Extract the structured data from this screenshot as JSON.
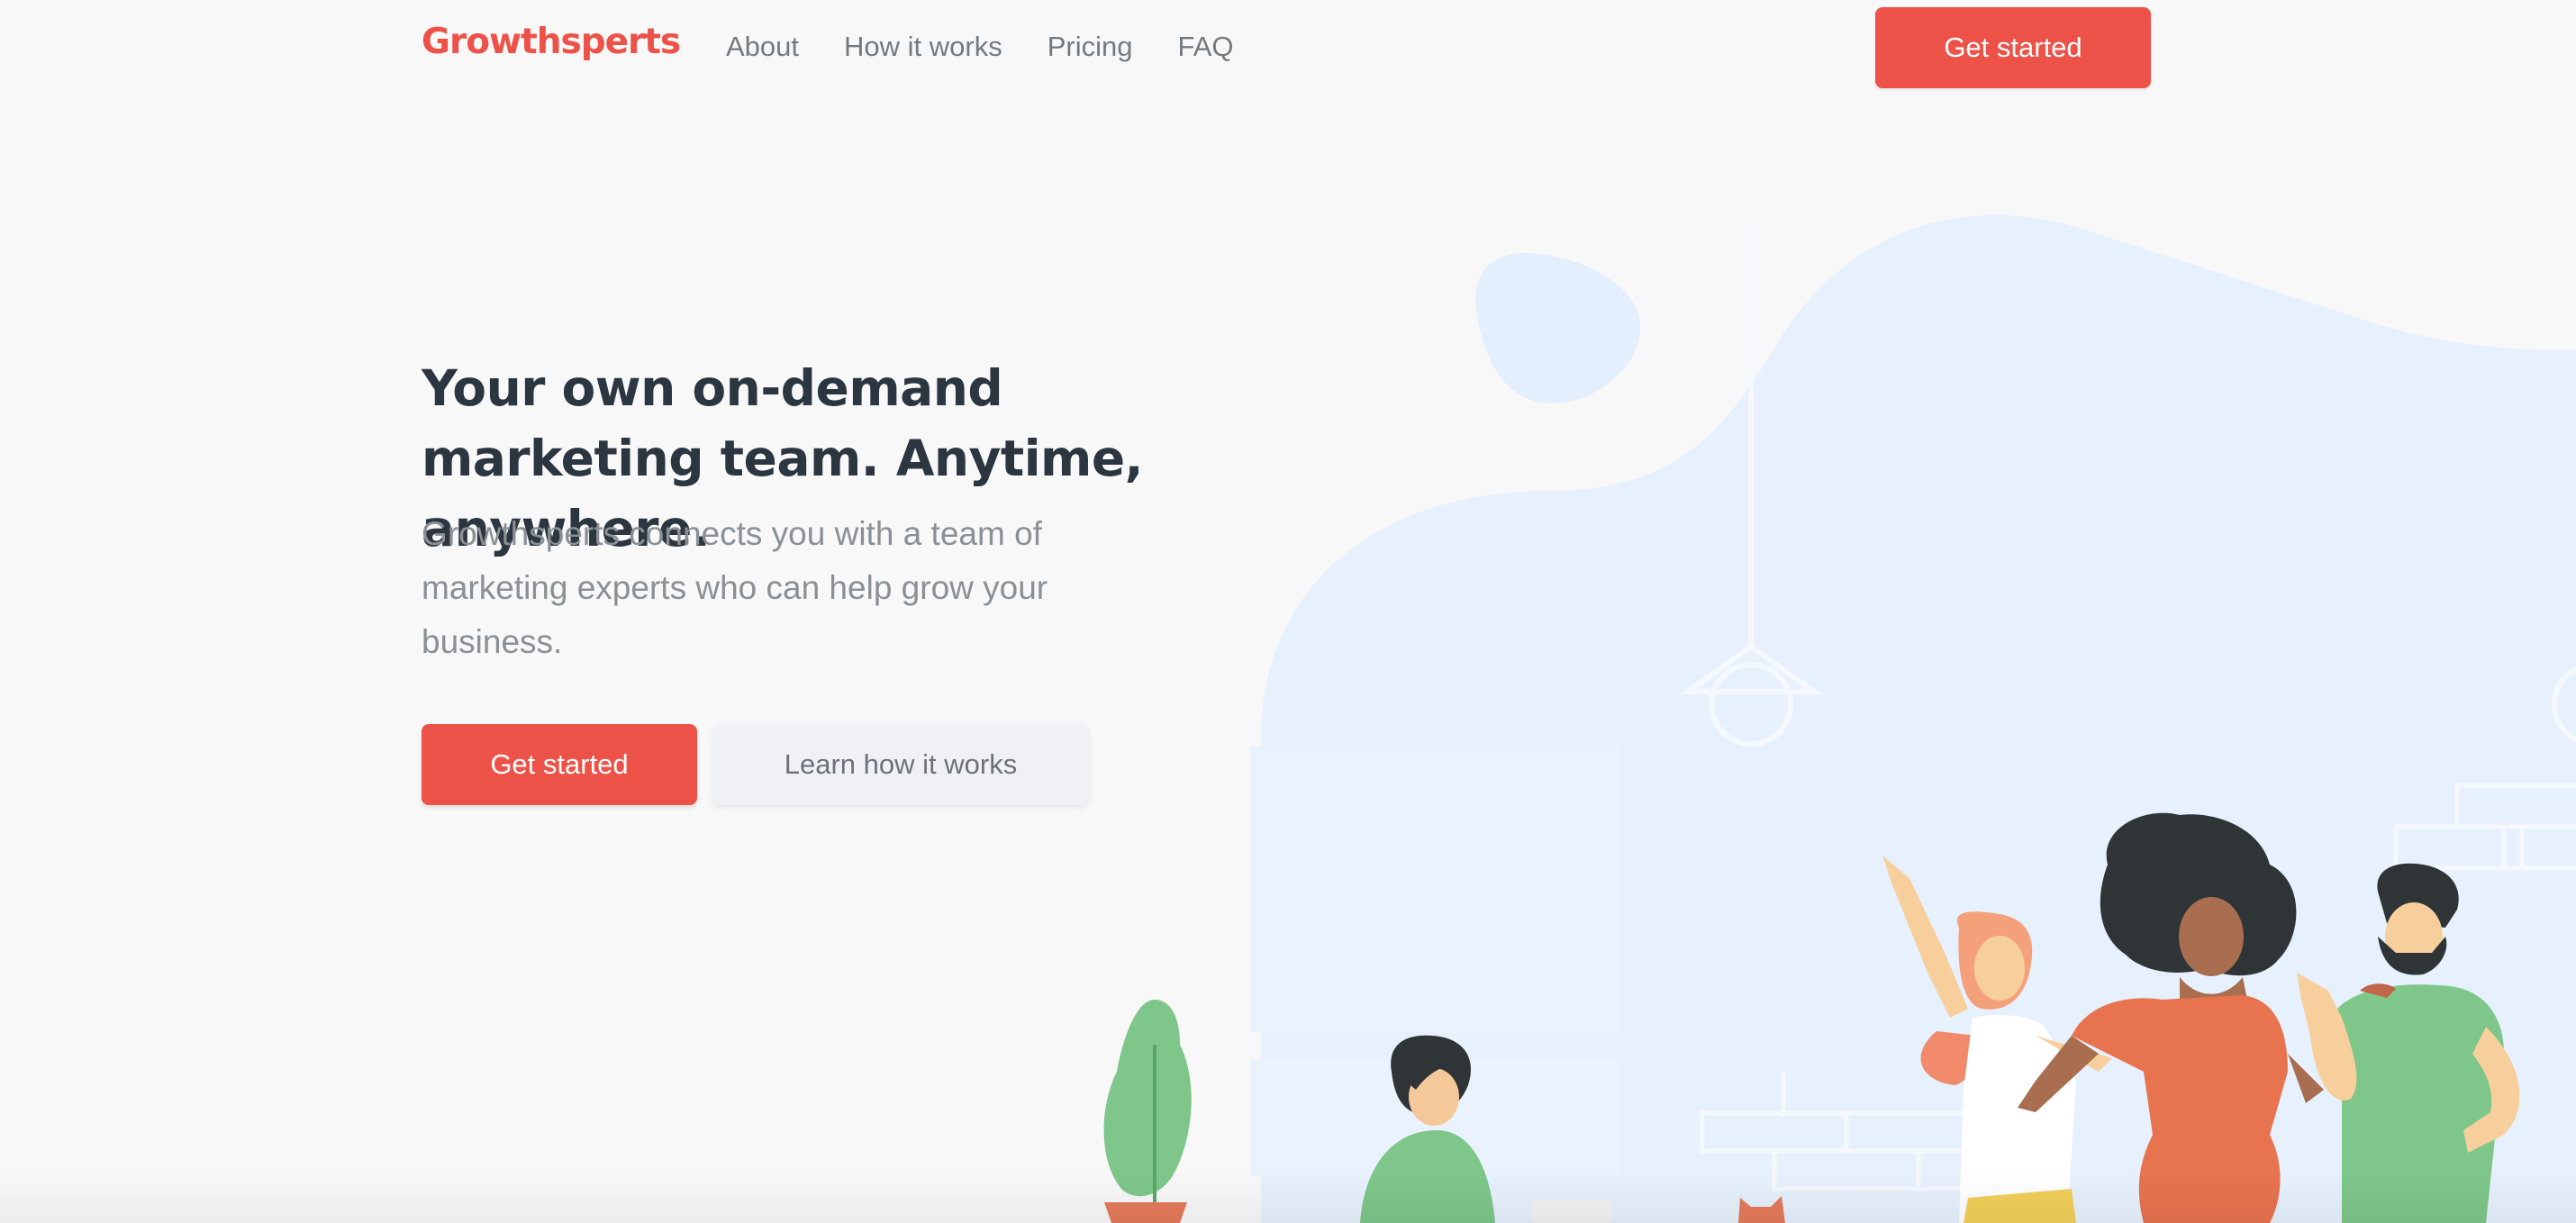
{
  "nav": {
    "logo": "Growthsperts",
    "links": [
      "About",
      "How it works",
      "Pricing",
      "FAQ"
    ],
    "cta_label": "Get started"
  },
  "hero": {
    "title": "Your own on-demand marketing team. Anytime, anywhere.",
    "subtitle": "Growthsperts connects you with a team of marketing experts who can help grow your business.",
    "primary_button": "Get started",
    "secondary_button": "Learn how it works"
  },
  "colors": {
    "brand": "#ec5248",
    "background": "#f8f8f8",
    "heading": "#2b3640",
    "body_text": "#8a9095",
    "illustration_bg": "#e6f1fd"
  }
}
